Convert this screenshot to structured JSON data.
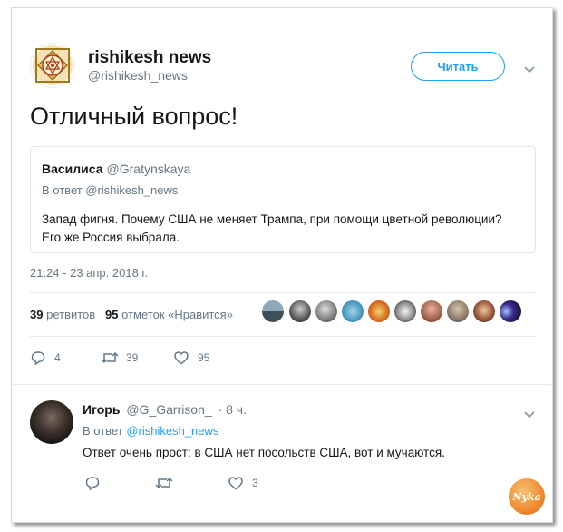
{
  "tweet": {
    "author_name": "rishikesh news",
    "author_handle": "@rishikesh_news",
    "follow_label": "Читать",
    "text": "Отличный вопрос!",
    "timestamp": "21:24 - 23 апр. 2018 г."
  },
  "quoted": {
    "name": "Василиса",
    "handle": "@Gratynskaya",
    "reply_to": "В ответ @rishikesh_news",
    "text_line1": "Запад фигня. Почему США не меняет Трампа, при помощи цветной революции?",
    "text_line2": "Его же Россия выбрала."
  },
  "stats": {
    "retweets_count": "39",
    "retweets_label": "ретвитов",
    "likes_count": "95",
    "likes_label": "отметок «Нравится»"
  },
  "actions": {
    "reply_count": "4",
    "retweet_count": "39",
    "like_count": "95"
  },
  "reply": {
    "name": "Игорь",
    "handle": "@G_Garrison_",
    "time": "· 8 ч.",
    "reply_prefix": "В ответ",
    "reply_to": "@rishikesh_news",
    "text": "Ответ очень прост: в США нет посольств США, вот и мучаются.",
    "like_count": "3"
  },
  "watermark": "Nyka",
  "colors": {
    "accent": "#1da1f2",
    "muted": "#657786",
    "text": "#14171a",
    "border": "#e1e8ed"
  }
}
